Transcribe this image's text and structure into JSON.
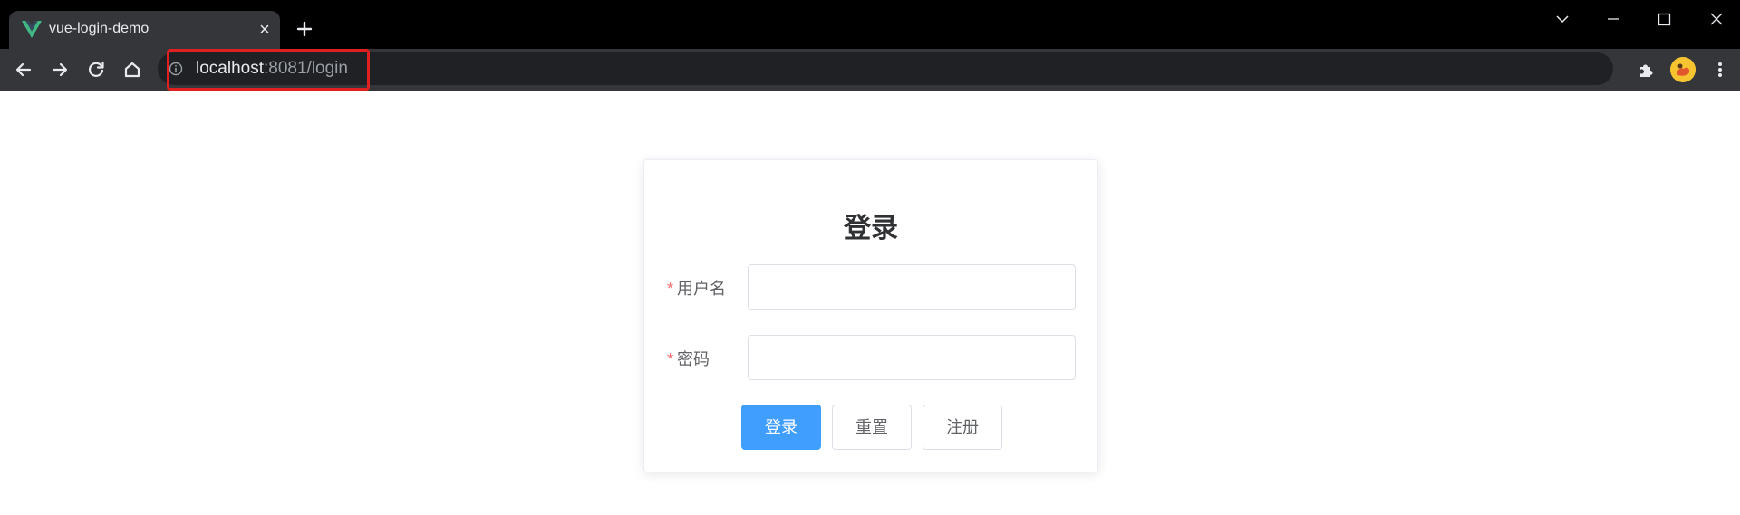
{
  "browser": {
    "tab_title": "vue-login-demo",
    "tab_close": "×",
    "url_host": "localhost",
    "url_rest": ":8081/login"
  },
  "login": {
    "title": "登录",
    "required_mark": "*",
    "username_label": "用户名",
    "password_label": "密码",
    "username_value": "",
    "password_value": "",
    "login_button": "登录",
    "reset_button": "重置",
    "register_button": "注册"
  },
  "colors": {
    "primary": "#409eff",
    "required": "#f56c6c",
    "highlight": "#e02020",
    "vue_green": "#41b883"
  },
  "icons": [
    "vue-logo-icon",
    "close-icon",
    "plus-icon",
    "chevron-down-icon",
    "minimize-icon",
    "maximize-icon",
    "window-close-icon",
    "back-icon",
    "forward-icon",
    "reload-icon",
    "home-icon",
    "info-icon",
    "share-icon",
    "star-icon",
    "extensions-icon",
    "menu-icon"
  ]
}
